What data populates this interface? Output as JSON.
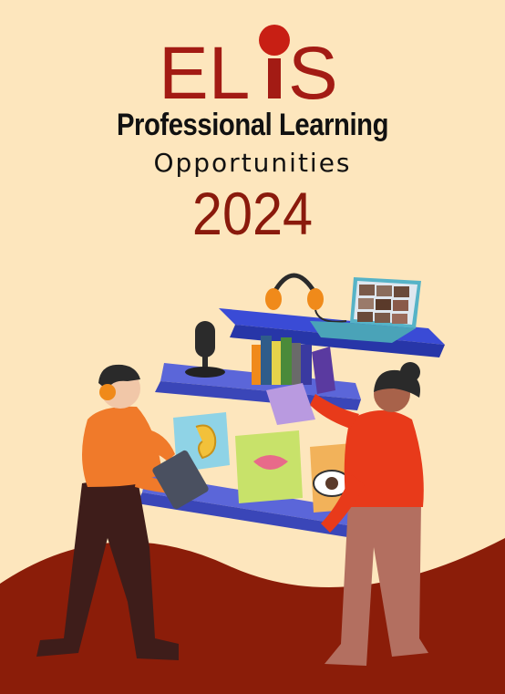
{
  "logo": {
    "text": "ELIS",
    "part1": "EL",
    "part2": "S"
  },
  "title": "Professional Learning",
  "subtitle": "Opportunities",
  "year": "2024",
  "colors": {
    "background": "#fde6bd",
    "hill": "#8b1d09",
    "logo": "#a31b14",
    "year": "#8a1a0c",
    "shelf": "#3a4bd6"
  }
}
